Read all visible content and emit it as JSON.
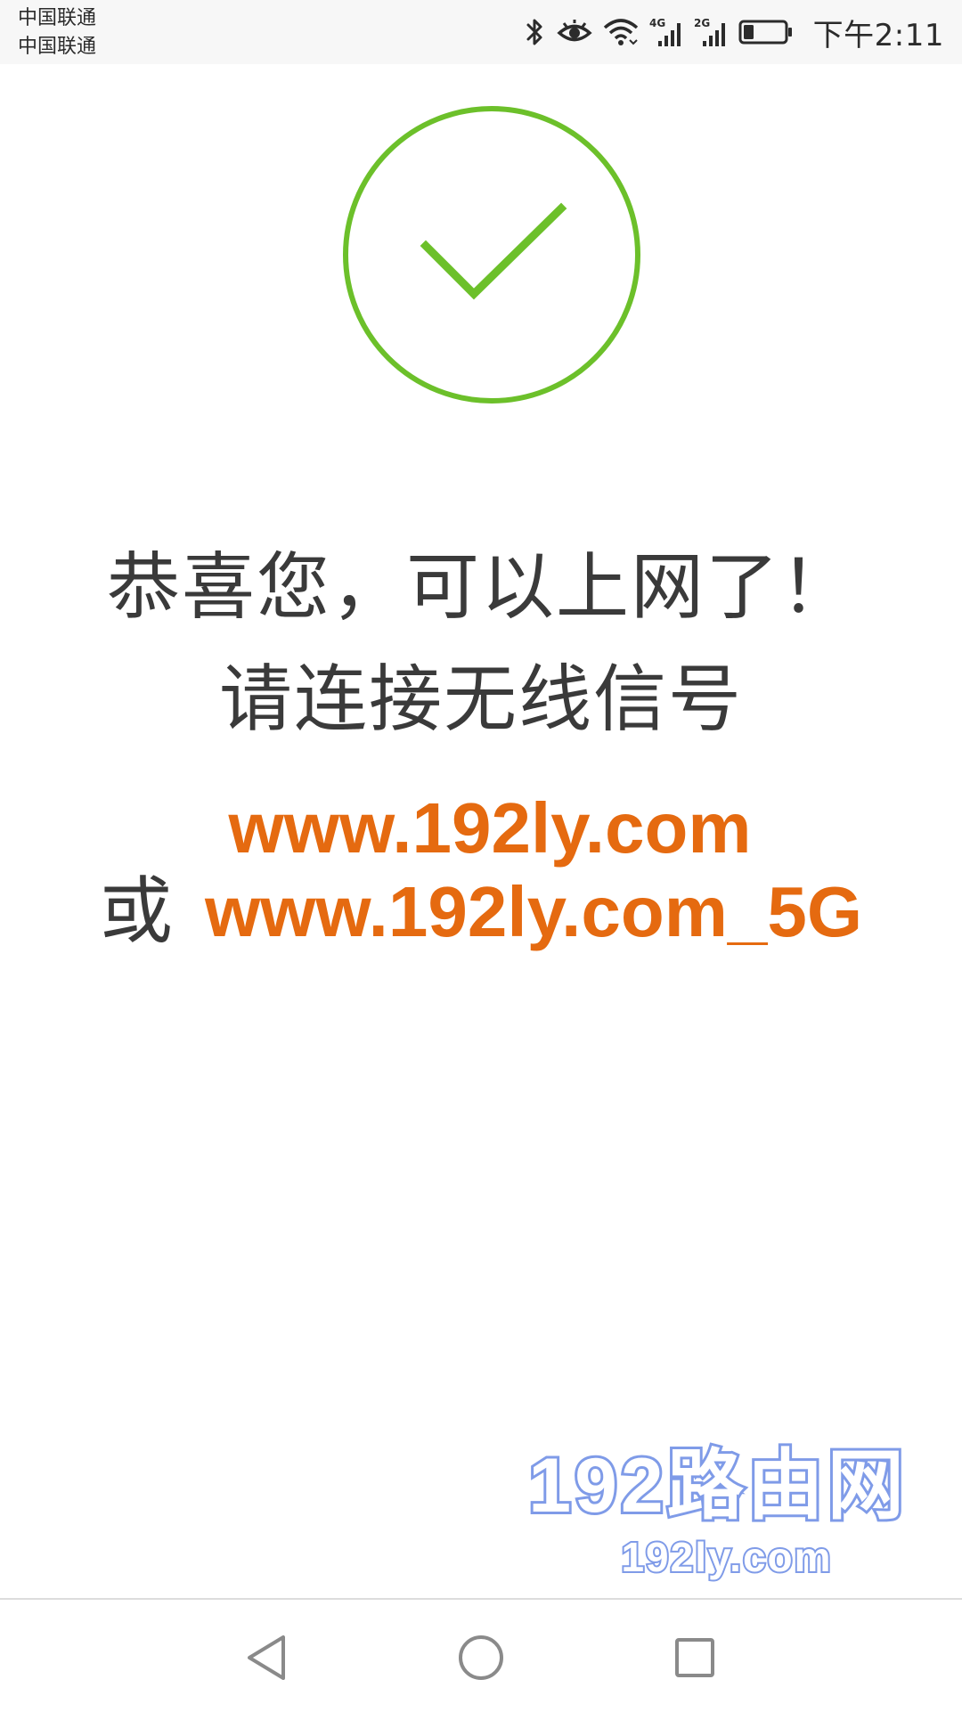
{
  "status_bar": {
    "carrier_1": "中国联通",
    "carrier_2": "中国联通",
    "icons": [
      "bluetooth-icon",
      "eye-comfort-icon",
      "wifi-icon",
      "signal-4g-icon",
      "signal-2g-icon",
      "battery-icon"
    ],
    "network_1": "4G",
    "network_2": "2G",
    "battery_level": 0.25,
    "time": "下午2:11"
  },
  "main": {
    "success_icon": "check-circle-icon",
    "success_color": "#6cc02a",
    "headline": "恭喜您，可以上网了！",
    "instruction": "请连接无线信号",
    "ssid_primary": "www.192ly.com",
    "or_label": "或",
    "ssid_secondary": "www.192ly.com_5G",
    "ssid_color": "#e56a10"
  },
  "watermark": {
    "line1": "192路由网",
    "line2": "192ly.com",
    "color": "#7f9be8"
  },
  "nav_bar": {
    "buttons": [
      "back-icon",
      "home-icon",
      "recent-apps-icon"
    ]
  }
}
